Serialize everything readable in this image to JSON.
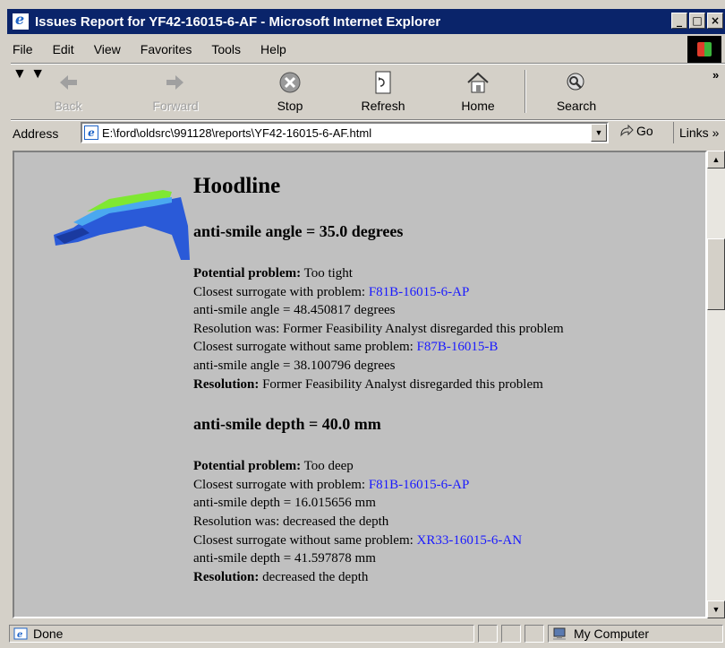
{
  "window": {
    "title": "Issues Report for YF42-16015-6-AF - Microsoft Internet Explorer",
    "minimize_glyph": "_",
    "maximize_glyph": "□",
    "close_glyph": "×"
  },
  "menu": [
    "File",
    "Edit",
    "View",
    "Favorites",
    "Tools",
    "Help"
  ],
  "toolbar": {
    "back": "Back",
    "forward": "Forward",
    "stop": "Stop",
    "refresh": "Refresh",
    "home": "Home",
    "search": "Search",
    "chevron": "»"
  },
  "address": {
    "label": "Address",
    "url": "E:\\ford\\oldsrc\\991128\\reports\\YF42-16015-6-AF.html",
    "go": "Go",
    "links": "Links »"
  },
  "report": {
    "part": "Hoodline",
    "issues": [
      {
        "heading": "anti-smile angle = 35.0 degrees",
        "problem_label": "Potential problem:",
        "problem": "Too tight",
        "closest_with_label": "Closest surrogate with problem:",
        "closest_with_link": "F81B-16015-6-AP",
        "closest_with_value": "anti-smile angle = 48.450817 degrees",
        "resolution_was": "Resolution was: Former Feasibility Analyst disregarded this problem",
        "closest_without_label": "Closest surrogate without same problem:",
        "closest_without_link": "F87B-16015-B",
        "closest_without_value": "anti-smile angle = 38.100796 degrees",
        "resolution_label": "Resolution:",
        "resolution": "Former Feasibility Analyst disregarded this problem"
      },
      {
        "heading": "anti-smile depth = 40.0 mm",
        "problem_label": "Potential problem:",
        "problem": "Too deep",
        "closest_with_label": "Closest surrogate with problem:",
        "closest_with_link": "F81B-16015-6-AP",
        "closest_with_value": "anti-smile depth = 16.015656 mm",
        "resolution_was": "Resolution was: decreased the depth",
        "closest_without_label": "Closest surrogate without same problem:",
        "closest_without_link": "XR33-16015-6-AN",
        "closest_without_value": "anti-smile depth = 41.597878 mm",
        "resolution_label": "Resolution:",
        "resolution": "decreased the depth"
      }
    ]
  },
  "status": {
    "text": "Done",
    "zone": "My Computer"
  },
  "colors": {
    "titlebar": "#0a246a",
    "link": "#1a1aff",
    "content_bg": "#c0c0c0",
    "chrome": "#d4d0c8"
  }
}
